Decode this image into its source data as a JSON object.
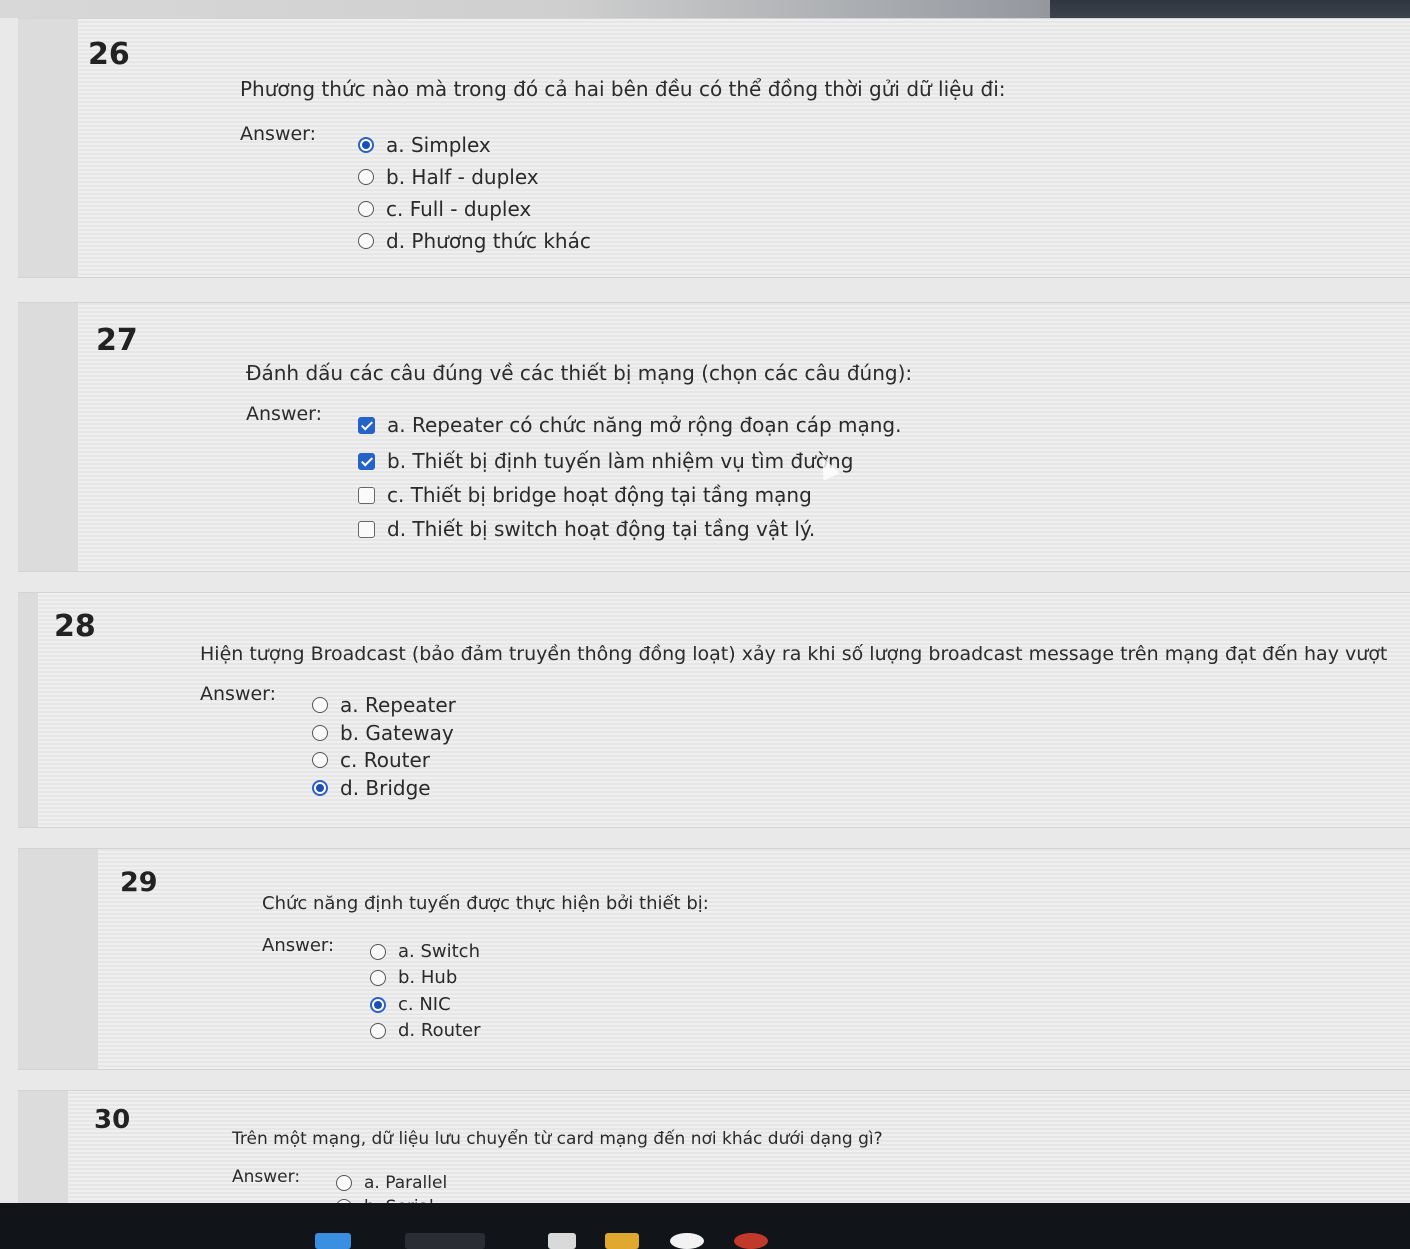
{
  "questions": [
    {
      "number": "26",
      "text": "Phương thức nào mà trong đó cả hai bên đều có thể đồng thời gửi dữ liệu đi:",
      "answer_label": "Answer:",
      "input_type": "radio",
      "options": [
        {
          "label": "a. Simplex",
          "selected": true
        },
        {
          "label": "b. Half - duplex",
          "selected": false
        },
        {
          "label": "c. Full - duplex",
          "selected": false
        },
        {
          "label": "d. Phương thức khác",
          "selected": false
        }
      ]
    },
    {
      "number": "27",
      "text": "Đánh dấu các câu đúng về các thiết bị mạng (chọn các câu đúng):",
      "answer_label": "Answer:",
      "input_type": "checkbox",
      "options": [
        {
          "label": "a. Repeater có chức năng mở rộng đoạn cáp mạng.",
          "selected": true
        },
        {
          "label": "b. Thiết bị định tuyến làm nhiệm vụ tìm đường",
          "selected": true
        },
        {
          "label": "c. Thiết bị bridge hoạt động tại tầng mạng",
          "selected": false
        },
        {
          "label": "d. Thiết bị switch hoạt động tại tầng vật lý.",
          "selected": false
        }
      ]
    },
    {
      "number": "28",
      "text": "Hiện tượng Broadcast (bảo đảm truyền thông đồng loạt) xảy ra khi số lượng broadcast message trên mạng đạt đến hay vượt",
      "answer_label": "Answer:",
      "input_type": "radio",
      "options": [
        {
          "label": "a. Repeater",
          "selected": false
        },
        {
          "label": "b. Gateway",
          "selected": false
        },
        {
          "label": "c. Router",
          "selected": false
        },
        {
          "label": "d. Bridge",
          "selected": true
        }
      ]
    },
    {
      "number": "29",
      "text": "Chức năng định tuyến được thực hiện bởi thiết bị:",
      "answer_label": "Answer:",
      "input_type": "radio",
      "options": [
        {
          "label": "a. Switch",
          "selected": false
        },
        {
          "label": "b. Hub",
          "selected": false
        },
        {
          "label": "c. NIC",
          "selected": true
        },
        {
          "label": "d. Router",
          "selected": false
        }
      ]
    },
    {
      "number": "30",
      "text": "Trên một mạng, dữ liệu lưu chuyển từ card mạng đến nơi khác dưới dạng gì?",
      "answer_label": "Answer:",
      "input_type": "radio",
      "options": [
        {
          "label": "a. Parallel",
          "selected": false
        },
        {
          "label": "b. Serial",
          "selected": false
        }
      ]
    }
  ],
  "colors": {
    "selected_accent": "#1b4fb8",
    "checkbox_fill": "#2563c9",
    "taskbar": "#111418"
  }
}
